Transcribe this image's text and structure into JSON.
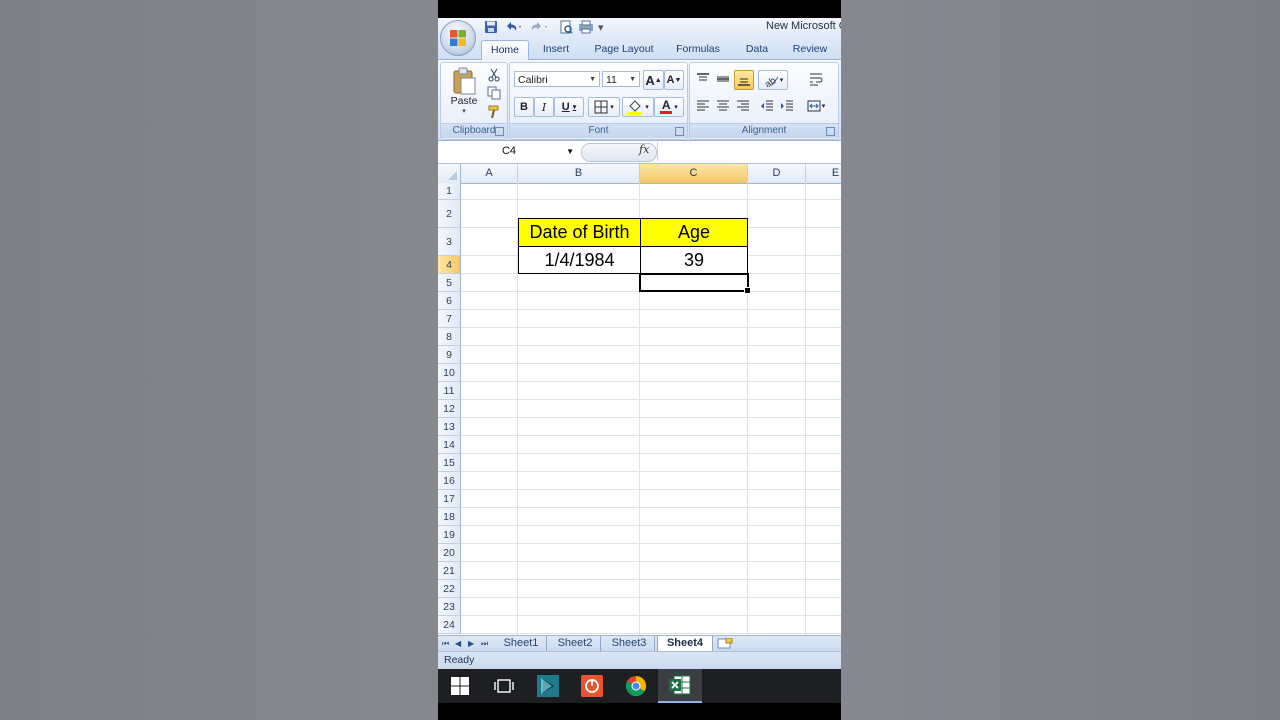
{
  "title_bar": {
    "document_title": "New Microsoft Off"
  },
  "ribbon": {
    "tabs": [
      "Home",
      "Insert",
      "Page Layout",
      "Formulas",
      "Data",
      "Review"
    ],
    "active_tab": "Home",
    "clipboard": {
      "paste_label": "Paste",
      "group_label": "Clipboard"
    },
    "font": {
      "name": "Calibri",
      "size": "11",
      "group_label": "Font",
      "bold": "B",
      "italic": "I",
      "underline": "U",
      "grow": "A",
      "shrink": "A",
      "font_color": "A"
    },
    "alignment": {
      "group_label": "Alignment"
    }
  },
  "formula_bar": {
    "name_box": "C4",
    "fx_label": "fx",
    "formula": ""
  },
  "grid": {
    "columns": [
      "A",
      "B",
      "C",
      "D",
      "E"
    ],
    "selected_column": "C",
    "rows": [
      "1",
      "2",
      "3",
      "4",
      "5",
      "6",
      "7",
      "8",
      "9",
      "10",
      "11",
      "12",
      "13",
      "14",
      "15",
      "16",
      "17",
      "18",
      "19",
      "20",
      "21",
      "22",
      "23",
      "24"
    ],
    "selected_row": "4",
    "cells": {
      "B2": "Date of Birth",
      "C2": "Age",
      "B3": "1/4/1984",
      "C3": "39"
    },
    "header_fill": "#ffff00"
  },
  "sheet_tabs": {
    "tabs": [
      "Sheet1",
      "Sheet2",
      "Sheet3",
      "Sheet4"
    ],
    "active": "Sheet4"
  },
  "status_bar": {
    "text": "Ready"
  },
  "taskbar": {
    "icons": [
      "windows-start-icon",
      "task-view-icon",
      "media-player-icon",
      "office-app-icon",
      "chrome-icon",
      "excel-icon"
    ]
  }
}
